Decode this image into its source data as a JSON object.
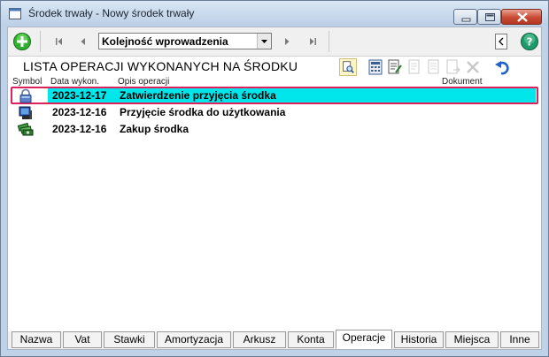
{
  "window": {
    "title": "Środek trwały - Nowy środek trwały"
  },
  "toolbar": {
    "sort_value": "Kolejność wprowadzenia",
    "icons": {
      "add": "add-green-plus-icon",
      "first": "first-record-icon",
      "prev": "previous-record-icon",
      "next": "next-record-icon",
      "last": "last-record-icon",
      "help": "help-icon"
    }
  },
  "list": {
    "title": "LISTA OPERACJI WYKONANYCH NA ŚRODKU",
    "columns": {
      "symbol": "Symbol",
      "date": "Data wykon.",
      "description": "Opis operacji",
      "document": "Dokument"
    },
    "rows": [
      {
        "date": "2023-12-17",
        "description": "Zatwierdzenie przyjęcia środka",
        "selected": true,
        "icon": "lock-approve-icon"
      },
      {
        "date": "2023-12-16",
        "description": "Przyjęcie środka do użytkowania",
        "selected": false,
        "icon": "monitor-asset-icon"
      },
      {
        "date": "2023-12-16",
        "description": "Zakup środka",
        "selected": false,
        "icon": "money-stack-icon"
      }
    ],
    "highlight_color": "#00e6ea",
    "frame_color": "#e0205a"
  },
  "tabs": [
    {
      "label": "Nazwa",
      "active": false
    },
    {
      "label": "Vat",
      "active": false
    },
    {
      "label": "Stawki",
      "active": false
    },
    {
      "label": "Amortyzacja",
      "active": false
    },
    {
      "label": "Arkusz",
      "active": false
    },
    {
      "label": "Konta",
      "active": false
    },
    {
      "label": "Operacje",
      "active": true
    },
    {
      "label": "Historia",
      "active": false
    },
    {
      "label": "Miejsca",
      "active": false
    },
    {
      "label": "Inne",
      "active": false
    }
  ]
}
